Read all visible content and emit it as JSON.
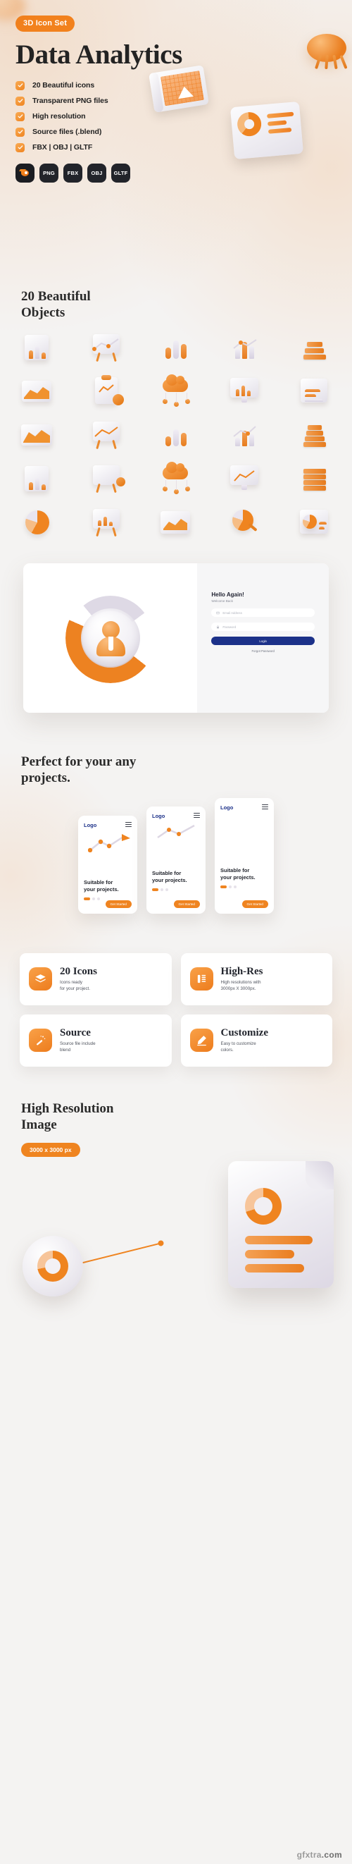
{
  "hero": {
    "badge": "3D Icon Set",
    "title": "Data Analytics",
    "features": [
      "20 Beautiful icons",
      "Transparent PNG files",
      "High resolution",
      "Source files (.blend)",
      "FBX | OBJ | GLTF"
    ],
    "formats": [
      "Blender",
      "PNG",
      "FBX",
      "OBJ",
      "GLTF"
    ]
  },
  "objects": {
    "title_line1": "20 Beautiful",
    "title_line2": "Objects",
    "items": [
      "document-chart-icon",
      "presentation-board-icon",
      "bar-chart-icon",
      "scatter-plot-icon",
      "stacked-data-icon",
      "area-chart-icon",
      "clipboard-report-icon",
      "cloud-data-icon",
      "monitor-dashboard-icon",
      "list-chart-icon",
      "histogram-icon",
      "line-graph-board-icon",
      "column-chart-icon",
      "growth-chart-icon",
      "database-stack-icon",
      "document-chart-icon",
      "presentation-board-icon",
      "cloud-data-icon",
      "monitor-dashboard-icon",
      "server-rack-icon",
      "pie-chart-icon",
      "easel-chart-icon",
      "framed-graph-icon",
      "magnifier-chart-icon",
      "window-report-icon"
    ]
  },
  "login_mockup": {
    "title": "Hello Again!",
    "subtitle": "Welcome Back",
    "email_placeholder": "Email Address",
    "password_placeholder": "Password",
    "submit_label": "Login",
    "forgot_label": "Forgot Password"
  },
  "projects": {
    "title_line1": "Perfect for your any",
    "title_line2": "projects.",
    "phones": [
      {
        "logo": "Logo",
        "caption_line1": "Suitable for",
        "caption_line2": "your projects.",
        "cta": "Get Started"
      },
      {
        "logo": "Logo",
        "caption_line1": "Suitable for",
        "caption_line2": "your projects.",
        "cta": "Get Started"
      },
      {
        "logo": "Logo",
        "caption_line1": "Suitable for",
        "caption_line2": "your projects.",
        "cta": "Get Started"
      }
    ]
  },
  "feature_cards": [
    {
      "icon": "layers-icon",
      "title": "20 Icons",
      "desc_line1": "Icons ready",
      "desc_line2": "for your project."
    },
    {
      "icon": "resize-icon",
      "title": "High-Res",
      "desc_line1": "High resolutions with",
      "desc_line2": "3000px X 3000px."
    },
    {
      "icon": "magic-wand-icon",
      "title": "Source",
      "desc_line1": "Source file include",
      "desc_line2": "blend"
    },
    {
      "icon": "pen-edit-icon",
      "title": "Customize",
      "desc_line1": "Easy to customize",
      "desc_line2": "colors."
    }
  ],
  "high_resolution": {
    "title_line1": "High Resolution",
    "title_line2": "Image",
    "pill": "3000 x 3000 px"
  },
  "footer": {
    "watermark_prefix": "gfxtra",
    "watermark_suffix": ".com"
  },
  "colors": {
    "accent_orange": "#ef8420",
    "deep_orange": "#d66a14",
    "lilac": "#ded9e6",
    "ink": "#23262e",
    "login_blue": "#1c3189",
    "chip_dark": "#22242a",
    "page_bg": "#f4f3f2"
  }
}
